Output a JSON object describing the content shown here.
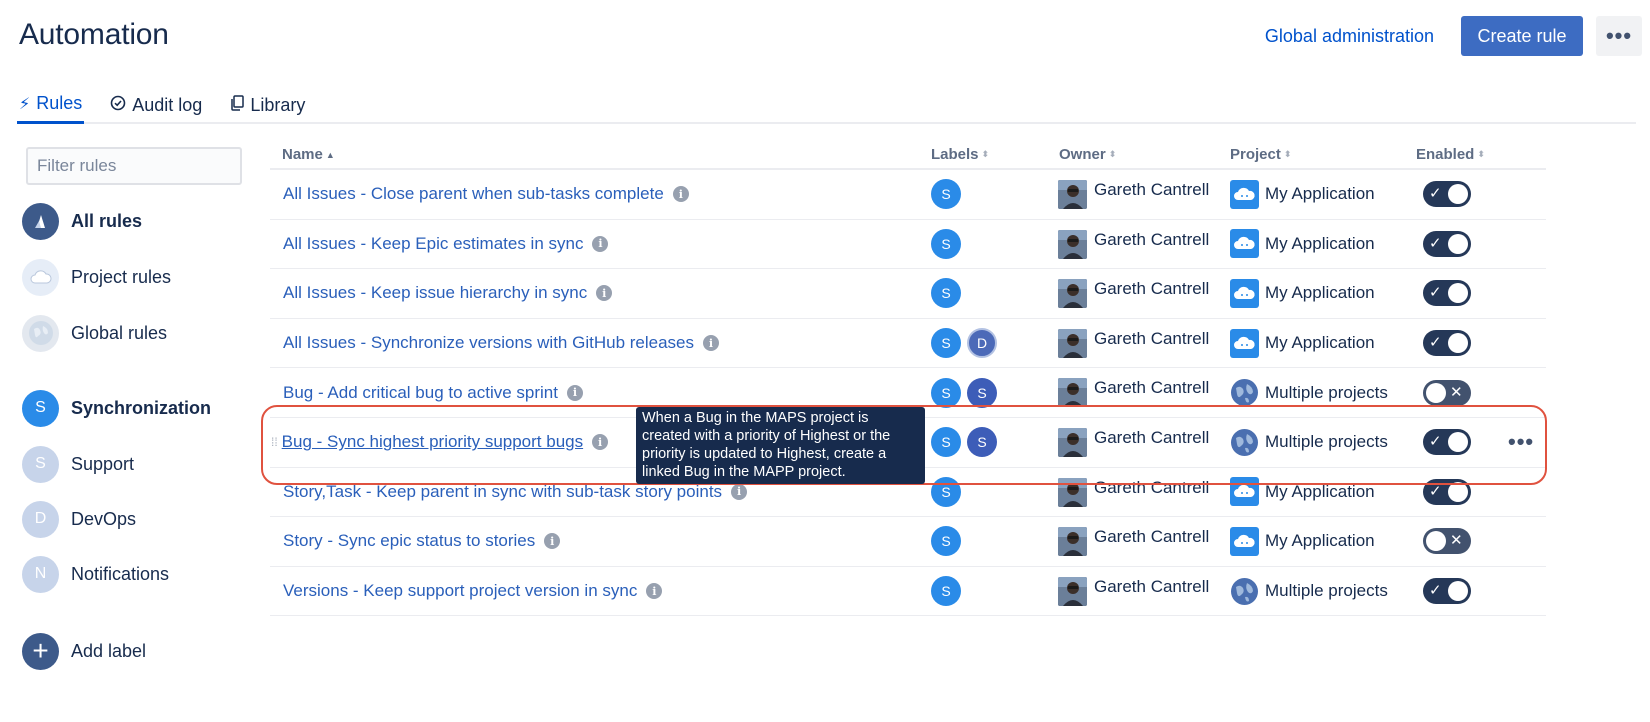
{
  "header": {
    "title": "Automation",
    "global_admin": "Global administration",
    "create_rule": "Create rule",
    "more": "•••"
  },
  "tabs": [
    {
      "label": "Rules",
      "icon": "lightning-icon",
      "glyph": "⚡"
    },
    {
      "label": "Audit log",
      "icon": "check-circle-icon",
      "glyph": "✓"
    },
    {
      "label": "Library",
      "icon": "copy-icon",
      "glyph": "❐"
    }
  ],
  "sidebar": {
    "filter_placeholder": "Filter rules",
    "items": [
      {
        "label": "All rules",
        "initial": "",
        "color": "#42526e",
        "bold": true
      },
      {
        "label": "Project rules",
        "initial": "",
        "color": "#dfe6f0",
        "bold": false
      },
      {
        "label": "Global rules",
        "initial": "",
        "color": "#dfe6f0",
        "bold": false
      },
      {
        "label": "Synchronization",
        "initial": "S",
        "color": "#2684ff",
        "bold": true
      },
      {
        "label": "Support",
        "initial": "S",
        "color": "#c1d3ef",
        "bold": false
      },
      {
        "label": "DevOps",
        "initial": "D",
        "color": "#c1d3ef",
        "bold": false
      },
      {
        "label": "Notifications",
        "initial": "N",
        "color": "#c1d3ef",
        "bold": false
      }
    ],
    "add_label": "Add label"
  },
  "table": {
    "columns": {
      "name": "Name",
      "labels": "Labels",
      "owner": "Owner",
      "project": "Project",
      "enabled": "Enabled"
    },
    "rows": [
      {
        "name": "All Issues - Close parent when sub-tasks complete",
        "labels": [
          "S"
        ],
        "owner": "Gareth Cantrell",
        "project": "My Application",
        "enabled": true
      },
      {
        "name": "All Issues - Keep Epic estimates in sync",
        "labels": [
          "S"
        ],
        "owner": "Gareth Cantrell",
        "project": "My Application",
        "enabled": true
      },
      {
        "name": "All Issues - Keep issue hierarchy in sync",
        "labels": [
          "S"
        ],
        "owner": "Gareth Cantrell",
        "project": "My Application",
        "enabled": true
      },
      {
        "name": "All Issues - Synchronize versions with GitHub releases",
        "labels": [
          "S",
          "D"
        ],
        "owner": "Gareth Cantrell",
        "project": "My Application",
        "enabled": true
      },
      {
        "name": "Bug - Add critical bug to active sprint",
        "labels": [
          "S",
          "S"
        ],
        "owner": "Gareth Cantrell",
        "project": "Multiple projects",
        "enabled": false
      },
      {
        "name": "Bug - Sync highest priority support bugs",
        "labels": [
          "S",
          "S"
        ],
        "owner": "Gareth Cantrell",
        "project": "Multiple projects",
        "enabled": true
      },
      {
        "name": "Story,Task - Keep parent in sync with sub-task story points",
        "labels": [
          "S"
        ],
        "owner": "Gareth Cantrell",
        "project": "My Application",
        "enabled": true
      },
      {
        "name": "Story - Sync epic status to stories",
        "labels": [
          "S"
        ],
        "owner": "Gareth Cantrell",
        "project": "My Application",
        "enabled": false
      },
      {
        "name": "Versions - Keep support project version in sync",
        "labels": [
          "S"
        ],
        "owner": "Gareth Cantrell",
        "project": "Multiple projects",
        "enabled": true
      }
    ],
    "row_more": "•••"
  },
  "tooltip": {
    "lines": [
      "When a Bug in the MAPS project is",
      "created with a priority of Highest or the",
      "priority is updated to Highest, create a",
      "linked Bug in the MAPP project."
    ]
  },
  "colors": {
    "accent": "#0052cc",
    "button": "#3d6cc2",
    "label_s_primary": "#2a8be8",
    "label_s_secondary": "#3d5db8",
    "label_d": "#4c6ab8",
    "toggle": "#253858",
    "highlight": "#e0523f"
  }
}
